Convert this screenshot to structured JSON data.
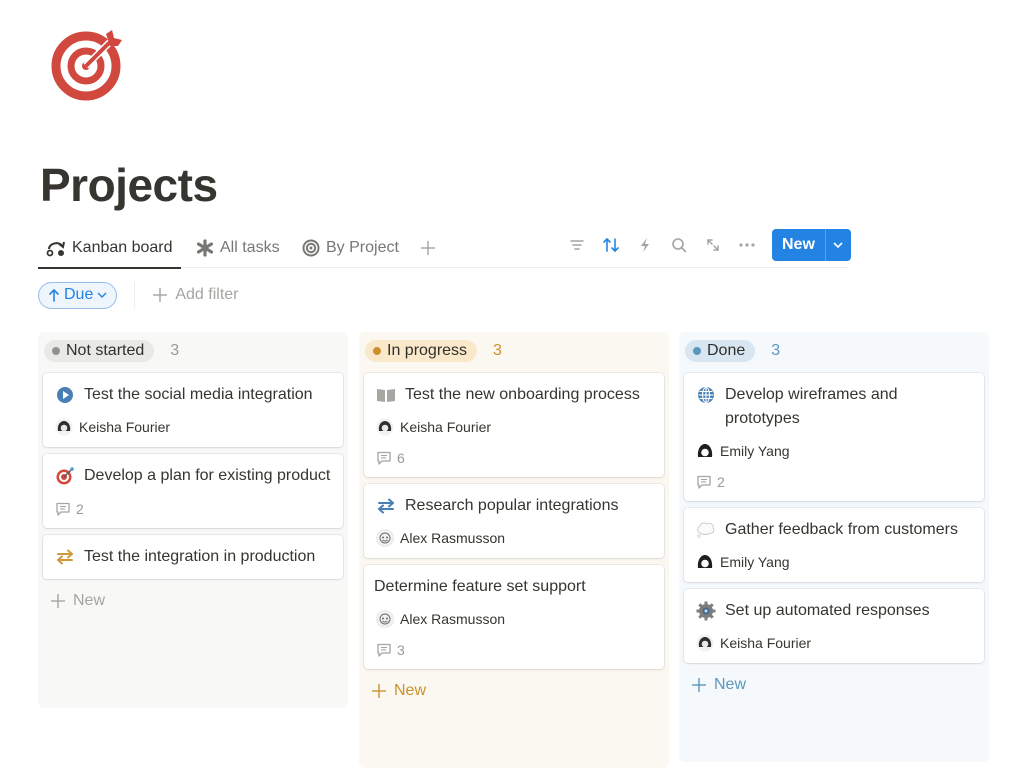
{
  "page": {
    "icon": "target-icon",
    "title": "Projects"
  },
  "tabs": [
    {
      "label": "Kanban board",
      "icon": "kanban-icon",
      "active": true
    },
    {
      "label": "All tasks",
      "icon": "asterisk-icon",
      "active": false
    },
    {
      "label": "By Project",
      "icon": "target-outline-icon",
      "active": false
    }
  ],
  "toolbar": {
    "icons": [
      "filter-icon",
      "sort-icon",
      "automation-bolt-icon",
      "search-icon",
      "expand-icon",
      "more-icon"
    ],
    "new_label": "New"
  },
  "filters": {
    "sort_label": "Due",
    "add_filter_label": "Add filter"
  },
  "colors": {
    "accent": "#2383e2",
    "not_started": "#91918e",
    "in_progress": "#cb912f",
    "done": "#5b97bd"
  },
  "columns": [
    {
      "status": "Not started",
      "count": "3",
      "new_label": "New",
      "cards": [
        {
          "title": "Test the social media integration",
          "icon": "play-circle-icon",
          "assignee": "Keisha Fourier"
        },
        {
          "title": "Develop a plan for existing product",
          "icon": "dart-target-icon",
          "comments": "2"
        },
        {
          "title": "Test the integration in production",
          "icon": "arrows-swap-icon"
        }
      ]
    },
    {
      "status": "In progress",
      "count": "3",
      "new_label": "New",
      "cards": [
        {
          "title": "Test the new onboarding process",
          "icon": "book-icon",
          "assignee": "Keisha Fourier",
          "comments": "6"
        },
        {
          "title": "Research popular integrations",
          "icon": "arrows-swap-icon",
          "assignee": "Alex Rasmusson"
        },
        {
          "title": "Determine feature set support",
          "assignee": "Alex Rasmusson",
          "comments": "3"
        }
      ]
    },
    {
      "status": "Done",
      "count": "3",
      "new_label": "New",
      "cards": [
        {
          "title": "Develop wireframes and prototypes",
          "icon": "globe-icon",
          "assignee": "Emily Yang",
          "comments": "2"
        },
        {
          "title": "Gather feedback from customers",
          "icon": "thought-bubble-icon",
          "assignee": "Emily Yang"
        },
        {
          "title": "Set up automated responses",
          "icon": "gear-icon",
          "assignee": "Keisha Fourier"
        }
      ]
    }
  ]
}
